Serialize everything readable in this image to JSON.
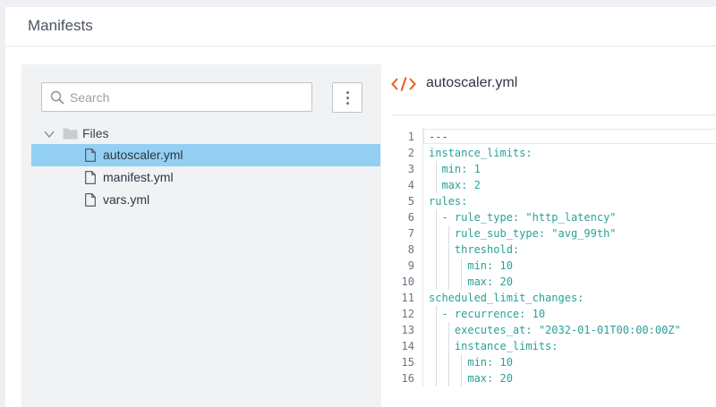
{
  "header": {
    "title": "Manifests"
  },
  "sidebar": {
    "search": {
      "placeholder": "Search",
      "value": "",
      "icon": "search-icon"
    },
    "menu_icon": "more-vertical-icon",
    "tree": {
      "folder": {
        "label": "Files",
        "expanded": true,
        "icon": "folder-icon"
      },
      "files": [
        {
          "label": "autoscaler.yml",
          "selected": true,
          "icon": "file-icon"
        },
        {
          "label": "manifest.yml",
          "selected": false,
          "icon": "file-icon"
        },
        {
          "label": "vars.yml",
          "selected": false,
          "icon": "file-icon"
        }
      ]
    }
  },
  "editor": {
    "filename": "autoscaler.yml",
    "icon": "code-icon",
    "icon_color": "#f05a22",
    "lines": [
      {
        "num": "1",
        "text": "---"
      },
      {
        "num": "2",
        "text": "instance_limits:"
      },
      {
        "num": "3",
        "text": "  min: 1"
      },
      {
        "num": "4",
        "text": "  max: 2"
      },
      {
        "num": "5",
        "text": "rules:"
      },
      {
        "num": "6",
        "text": "  - rule_type: \"http_latency\""
      },
      {
        "num": "7",
        "text": "    rule_sub_type: \"avg_99th\""
      },
      {
        "num": "8",
        "text": "    threshold:"
      },
      {
        "num": "9",
        "text": "      min: 10"
      },
      {
        "num": "10",
        "text": "      max: 20"
      },
      {
        "num": "11",
        "text": "scheduled_limit_changes:"
      },
      {
        "num": "12",
        "text": "  - recurrence: 10"
      },
      {
        "num": "13",
        "text": "    executes_at: \"2032-01-01T00:00:00Z\""
      },
      {
        "num": "14",
        "text": "    instance_limits:"
      },
      {
        "num": "15",
        "text": "      min: 10"
      },
      {
        "num": "16",
        "text": "      max: 20"
      }
    ]
  },
  "colors": {
    "selected_row": "#93cff3",
    "yaml_key": "#2aa198",
    "yaml_string": "#3a6f8a",
    "accent": "#f05a22"
  }
}
